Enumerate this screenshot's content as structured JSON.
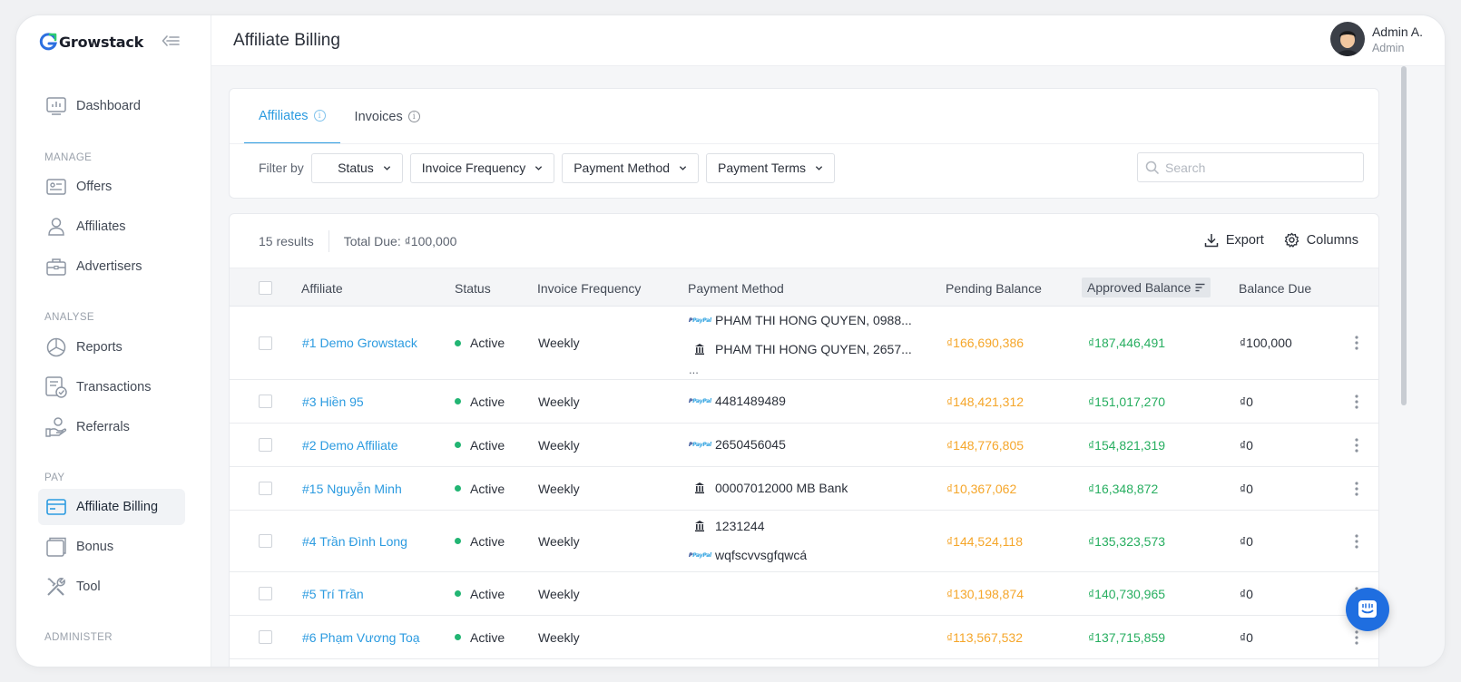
{
  "app": {
    "brand": "Growstack"
  },
  "header": {
    "title": "Affiliate Billing",
    "user_name": "Admin A.",
    "user_role": "Admin"
  },
  "sidebar": {
    "sections": {
      "manage": "MANAGE",
      "analyse": "ANALYSE",
      "pay": "PAY",
      "administer": "ADMINISTER"
    },
    "items": [
      {
        "label": "Dashboard",
        "icon": "dashboard-icon"
      },
      {
        "label": "Offers",
        "icon": "offers-icon"
      },
      {
        "label": "Affiliates",
        "icon": "user-icon"
      },
      {
        "label": "Advertisers",
        "icon": "briefcase-icon"
      },
      {
        "label": "Reports",
        "icon": "pie-chart-icon"
      },
      {
        "label": "Transactions",
        "icon": "transactions-icon"
      },
      {
        "label": "Referrals",
        "icon": "referrals-icon"
      },
      {
        "label": "Affiliate Billing",
        "icon": "credit-card-icon",
        "active": true
      },
      {
        "label": "Bonus",
        "icon": "bonus-icon"
      },
      {
        "label": "Tool",
        "icon": "tools-icon"
      }
    ]
  },
  "tabs": [
    {
      "label": "Affiliates",
      "active": true
    },
    {
      "label": "Invoices",
      "active": false
    }
  ],
  "filters": {
    "label": "Filter by",
    "items": [
      "Status",
      "Invoice Frequency",
      "Payment Method",
      "Payment Terms"
    ],
    "search_placeholder": "Search"
  },
  "summary": {
    "results": "15 results",
    "total_due": "Total Due: ₫100,000"
  },
  "actions": {
    "export": "Export",
    "columns": "Columns"
  },
  "table": {
    "columns": [
      "Affiliate",
      "Status",
      "Invoice Frequency",
      "Payment Method",
      "Pending Balance",
      "Approved Balance",
      "Balance Due"
    ],
    "sorted_column": "Approved Balance",
    "rows": [
      {
        "affiliate": "#1 Demo Growstack",
        "status": "Active",
        "frequency": "Weekly",
        "methods": [
          {
            "type": "paypal",
            "text": "PHAM THI HONG QUYEN, 0988..."
          },
          {
            "type": "bank",
            "text": "PHAM THI HONG QUYEN, 2657..."
          }
        ],
        "more": "...",
        "pending": "₫166,690,386",
        "approved": "₫187,446,491",
        "due": "₫100,000"
      },
      {
        "affiliate": "#3 Hiền 95",
        "status": "Active",
        "frequency": "Weekly",
        "methods": [
          {
            "type": "paypal",
            "text": "4481489489"
          }
        ],
        "pending": "₫148,421,312",
        "approved": "₫151,017,270",
        "due": "₫0"
      },
      {
        "affiliate": "#2 Demo Affiliate",
        "status": "Active",
        "frequency": "Weekly",
        "methods": [
          {
            "type": "paypal",
            "text": "2650456045"
          }
        ],
        "pending": "₫148,776,805",
        "approved": "₫154,821,319",
        "due": "₫0"
      },
      {
        "affiliate": "#15 Nguyễn Minh",
        "status": "Active",
        "frequency": "Weekly",
        "methods": [
          {
            "type": "bank",
            "text": "00007012000 MB Bank"
          }
        ],
        "pending": "₫10,367,062",
        "approved": "₫16,348,872",
        "due": "₫0"
      },
      {
        "affiliate": "#4 Trần Đình Long",
        "status": "Active",
        "frequency": "Weekly",
        "methods": [
          {
            "type": "bank",
            "text": "1231244"
          },
          {
            "type": "paypal",
            "text": "wqfscvvsgfqwcá"
          }
        ],
        "pending": "₫144,524,118",
        "approved": "₫135,323,573",
        "due": "₫0"
      },
      {
        "affiliate": "#5 Trí Trần",
        "status": "Active",
        "frequency": "Weekly",
        "methods": [],
        "pending": "₫130,198,874",
        "approved": "₫140,730,965",
        "due": "₫0"
      },
      {
        "affiliate": "#6 Phạm Vương Toạ",
        "status": "Active",
        "frequency": "Weekly",
        "methods": [],
        "pending": "₫113,567,532",
        "approved": "₫137,715,859",
        "due": "₫0"
      }
    ]
  },
  "colors": {
    "accent": "#2c9be0",
    "pending": "#f5a62a",
    "approved": "#27ae60",
    "active_dot": "#22b573",
    "chat": "#1f6ee0"
  }
}
